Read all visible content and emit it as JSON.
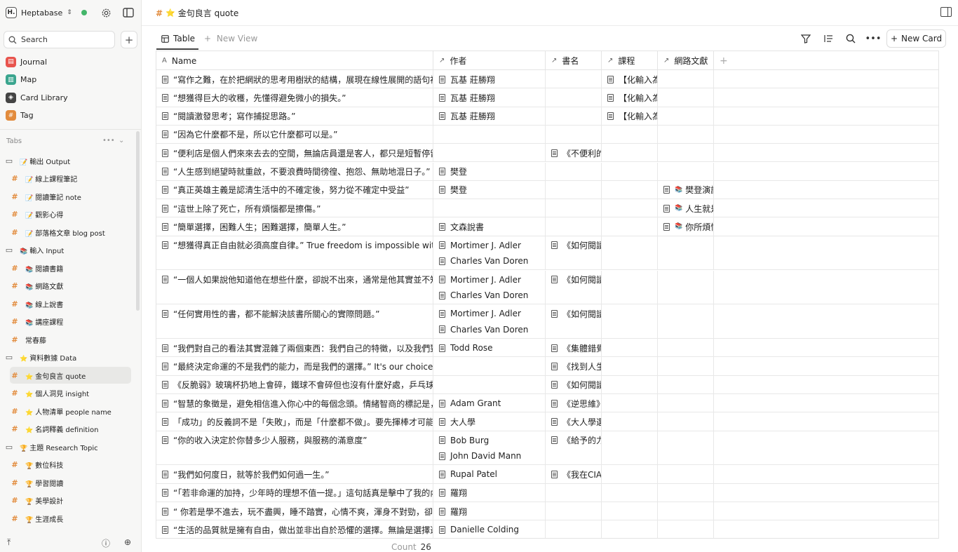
{
  "workspace": {
    "logo": "H.",
    "name": "Heptabase"
  },
  "search": {
    "label": "Search"
  },
  "nav": [
    {
      "label": "Journal",
      "color": "#e8544d",
      "icon": "calendar-icon",
      "glyph": "▤"
    },
    {
      "label": "Map",
      "color": "#3aa58e",
      "icon": "map-icon",
      "glyph": "▥"
    },
    {
      "label": "Card Library",
      "color": "#444444",
      "icon": "library-icon",
      "glyph": "◈"
    },
    {
      "label": "Tag",
      "color": "#e28b3c",
      "icon": "tag-icon",
      "glyph": "#"
    }
  ],
  "tabs_label": "Tabs",
  "tree": [
    {
      "type": "folder",
      "emoji": "📝",
      "label": "輸出 Output"
    },
    {
      "type": "tag",
      "emoji": "📝",
      "label": "線上課程筆記"
    },
    {
      "type": "tag",
      "emoji": "📝",
      "label": "閱讀筆記 note"
    },
    {
      "type": "tag",
      "emoji": "📝",
      "label": "觀影心得"
    },
    {
      "type": "tag",
      "emoji": "📝",
      "label": "部落格文章 blog post"
    },
    {
      "type": "folder",
      "emoji": "📚",
      "label": "輸入 Input"
    },
    {
      "type": "tag",
      "emoji": "📚",
      "label": "閱讀書籍"
    },
    {
      "type": "tag",
      "emoji": "📚",
      "label": "網路文獻"
    },
    {
      "type": "tag",
      "emoji": "📚",
      "label": "線上說書"
    },
    {
      "type": "tag",
      "emoji": "📚",
      "label": "講座課程"
    },
    {
      "type": "tag",
      "emoji": "",
      "label": "常春藤"
    },
    {
      "type": "folder",
      "emoji": "⭐",
      "label": "資料數據 Data"
    },
    {
      "type": "tag",
      "emoji": "⭐",
      "label": "金句良言 quote",
      "active": true
    },
    {
      "type": "tag",
      "emoji": "⭐",
      "label": "個人洞見 insight"
    },
    {
      "type": "tag",
      "emoji": "⭐",
      "label": "人物清單 people name"
    },
    {
      "type": "tag",
      "emoji": "⭐",
      "label": "名詞釋義 definition"
    },
    {
      "type": "folder",
      "emoji": "🏆",
      "label": "主題 Research Topic"
    },
    {
      "type": "tag",
      "emoji": "🏆",
      "label": "數位科技"
    },
    {
      "type": "tag",
      "emoji": "🏆",
      "label": "學習閱讀"
    },
    {
      "type": "tag",
      "emoji": "🏆",
      "label": "美學設計"
    },
    {
      "type": "tag",
      "emoji": "🏆",
      "label": "生涯成長"
    }
  ],
  "page": {
    "emoji": "⭐",
    "title": "金句良言 quote"
  },
  "view": {
    "tab_label": "Table",
    "new_view_label": "New View",
    "new_card_label": "New Card"
  },
  "columns": [
    {
      "label": "Name",
      "icon": "text-icon"
    },
    {
      "label": "作者",
      "icon": "relation-icon"
    },
    {
      "label": "書名",
      "icon": "relation-icon"
    },
    {
      "label": "課程",
      "icon": "relation-icon"
    },
    {
      "label": "網路文獻",
      "icon": "relation-icon"
    }
  ],
  "rows": [
    {
      "name": "“寫作之難，在於把網狀的思考用樹狀的結構，展現在線性展開的語句裡。”",
      "authors": [
        "瓦基 莊勝翔"
      ],
      "books": [],
      "courses": [
        "【化輸入為"
      ],
      "web": []
    },
    {
      "name": "“想獲得巨大的收穫，先懂得避免微小的損失。”",
      "authors": [
        "瓦基 莊勝翔"
      ],
      "books": [],
      "courses": [
        "【化輸入為"
      ],
      "web": []
    },
    {
      "name": "“閱讀激發思考；寫作捕捉思路。”",
      "authors": [
        "瓦基 莊勝翔"
      ],
      "books": [],
      "courses": [
        "【化輸入為"
      ],
      "web": []
    },
    {
      "name": "“因為它什麼都不是，所以它什麼都可以是。”",
      "authors": [],
      "books": [],
      "courses": [],
      "web": []
    },
    {
      "name": "“便利店是個人們來來去去的空間，無論店員還是客人，都只是短暫停留的過",
      "authors": [],
      "books": [
        "《不便利的"
      ],
      "courses": [],
      "web": []
    },
    {
      "name": "“人生感到絕望時就重啟，不要浪費時間徬徨、抱怨、無助地混日子。”",
      "authors": [
        "樊登"
      ],
      "books": [],
      "courses": [],
      "web": []
    },
    {
      "name": "“真正英雄主義是認清生活中的不確定後，努力從不確定中受益”",
      "authors": [
        "樊登"
      ],
      "books": [],
      "courses": [],
      "web": [
        "樊登演講"
      ]
    },
    {
      "name": "“這世上除了死亡，所有煩惱都是擦傷。”",
      "authors": [],
      "books": [],
      "courses": [],
      "web": [
        "人生就是"
      ]
    },
    {
      "name": "“簡單選擇，困難人生；困難選擇，簡單人生。”",
      "authors": [
        "文森說書"
      ],
      "books": [],
      "courses": [],
      "web": [
        "你所煩惱"
      ]
    },
    {
      "name": "“想獲得真正自由就必須高度自律。” True freedom is impossible without a",
      "authors": [
        "Mortimer J. Adler",
        "Charles Van Doren"
      ],
      "books": [
        "《如何閱讀"
      ],
      "courses": [],
      "web": []
    },
    {
      "name": "“一個人如果說他知道他在想些什麼，卻說不出來，通常是他其實並不知道自",
      "authors": [
        "Mortimer J. Adler",
        "Charles Van Doren"
      ],
      "books": [
        "《如何閱讀"
      ],
      "courses": [],
      "web": []
    },
    {
      "name": "“任何實用性的書，都不能解決該書所關心的實際問題。”",
      "authors": [
        "Mortimer J. Adler",
        "Charles Van Doren"
      ],
      "books": [
        "《如何閱讀"
      ],
      "courses": [],
      "web": []
    },
    {
      "name": "“我們對自己的看法其實混雜了兩個東西：我們自己的特徵，以及我們對內屬",
      "authors": [
        "Todd Rose"
      ],
      "books": [
        "《集體錯覺"
      ],
      "courses": [],
      "web": []
    },
    {
      "name": "“最終決定命運的不是我們的能力，而是我們的選擇。” It's our choices that",
      "authors": [],
      "books": [
        "《找到人生"
      ],
      "courses": [],
      "web": []
    },
    {
      "name": "《反脆弱》玻璃杯扔地上會碎，鐵球不會碎但也沒有什麼好處，乒乓球會彈起",
      "authors": [],
      "books": [
        "《如何閱讀"
      ],
      "courses": [],
      "web": []
    },
    {
      "name": "“智慧的象徵是，避免相信進入你心中的每個念頭。情緒智商的標記是，避免",
      "authors": [
        "Adam Grant"
      ],
      "books": [
        "《逆思維》"
      ],
      "courses": [],
      "web": []
    },
    {
      "name": "「成功」的反義詞不是「失敗」，而是「什麼都不做」。要先揮棒才可能有全",
      "authors": [
        "大人學"
      ],
      "books": [
        "《大人學選"
      ],
      "courses": [],
      "web": []
    },
    {
      "name": "“你的收入決定於你替多少人服務，與服務的滿意度”",
      "authors": [
        "Bob Burg",
        "John David Mann"
      ],
      "books": [
        "《給予的力"
      ],
      "courses": [],
      "web": []
    },
    {
      "name": "“我們如何度日，就等於我們如何過一生。”",
      "authors": [
        "Rupal Patel"
      ],
      "books": [
        "《我在CIA!"
      ],
      "courses": [],
      "web": []
    },
    {
      "name": "“「若非命運的加持，少年時的理想不值一提。」這句話真是擊中了我的內心",
      "authors": [
        "羅翔"
      ],
      "books": [],
      "courses": [],
      "web": []
    },
    {
      "name": "“ 你若是學不進去，玩不盡興，睡不踏實，心情不爽，渾身不對勁，卻又貪戀",
      "authors": [
        "羅翔"
      ],
      "books": [],
      "courses": [],
      "web": []
    },
    {
      "name": "“生活的品質就是擁有自由，做出並非出自於恐懼的選擇。無論是選擇進行哪",
      "authors": [
        "Danielle Colding"
      ],
      "books": [],
      "courses": [],
      "web": []
    }
  ],
  "footer": {
    "count_label": "Count",
    "count_value": "26"
  }
}
